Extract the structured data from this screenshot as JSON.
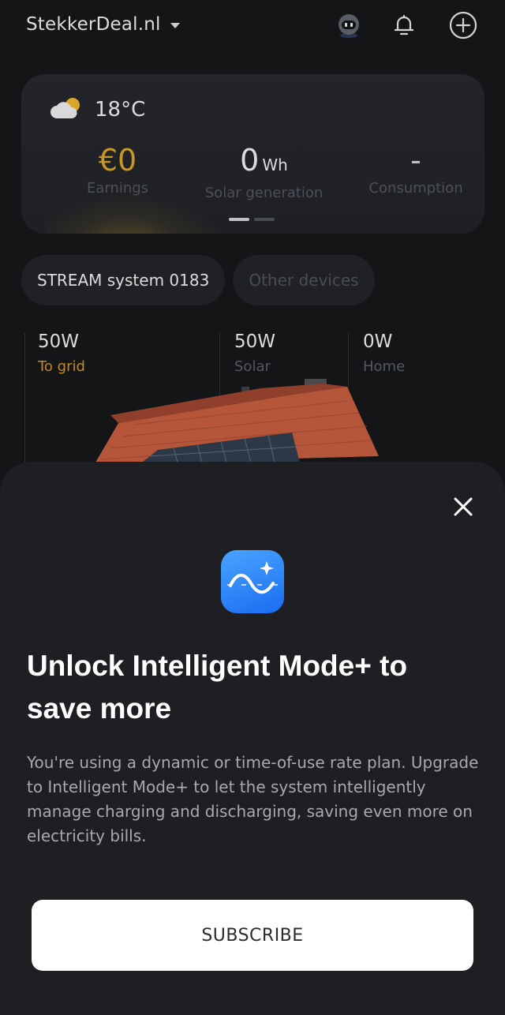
{
  "header": {
    "brand": "StekkerDeal.nl",
    "icons": [
      "robot-icon",
      "bell-icon",
      "plus-circle-icon"
    ]
  },
  "stats": {
    "temperature": "18°C",
    "earnings": {
      "value": "€0",
      "label": "Earnings"
    },
    "solar": {
      "value": "0",
      "unit": "Wh",
      "label": "Solar generation"
    },
    "consumption": {
      "value": "-",
      "label": "Consumption"
    },
    "pages": 2,
    "active_page": 0
  },
  "devices": {
    "tabs": [
      {
        "label": "STREAM system 0183",
        "active": true
      },
      {
        "label": "Other devices",
        "active": false
      }
    ]
  },
  "flow": {
    "to_grid": {
      "value": "50W",
      "label": "To grid"
    },
    "solar": {
      "value": "50W",
      "label": "Solar"
    },
    "home": {
      "value": "0W",
      "label": "Home"
    }
  },
  "sheet": {
    "title": "Unlock Intelligent Mode+ to save more",
    "description": "You're using a dynamic or time-of-use rate plan. Upgrade to Intelligent Mode+ to let the system intelligently manage charging and discharging, saving even more on electricity bills.",
    "button_label": "SUBSCRIBE"
  },
  "colors": {
    "background": "#141517",
    "card": "#23252a",
    "sheet": "#1e1f22",
    "earnings_gold": "#c99822",
    "grid_orange": "#c2891e",
    "feature_blue": "#1a6cf0",
    "button": "#ffffff"
  }
}
